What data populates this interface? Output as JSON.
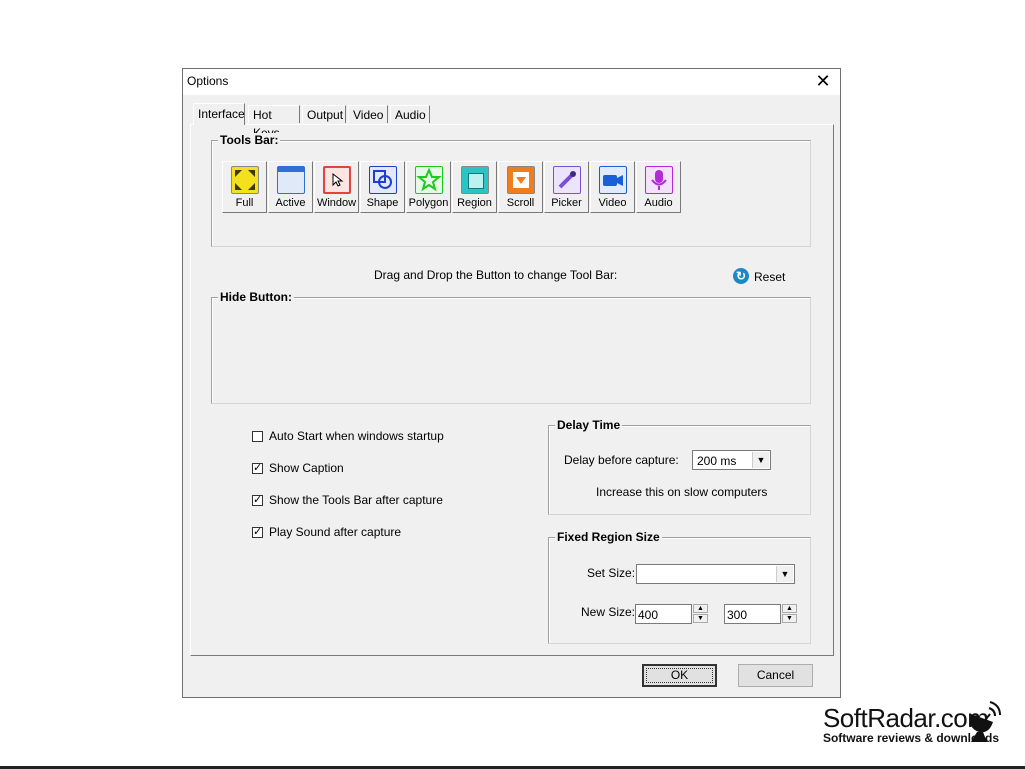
{
  "dialog": {
    "title": "Options",
    "tabs": [
      "Interface",
      "Hot Keys",
      "Output",
      "Video",
      "Audio"
    ],
    "active_tab": "Interface"
  },
  "tools_bar": {
    "label": "Tools Bar:",
    "buttons": [
      {
        "label": "Full",
        "icon": "full-screen-icon",
        "color": "#f2e11c"
      },
      {
        "label": "Active",
        "icon": "active-window-icon",
        "color": "#2f6fd6"
      },
      {
        "label": "Window",
        "icon": "window-cursor-icon",
        "color": "#e0443c"
      },
      {
        "label": "Shape",
        "icon": "shape-icon",
        "color": "#1d3fd0"
      },
      {
        "label": "Polygon",
        "icon": "polygon-star-icon",
        "color": "#1ec81e"
      },
      {
        "label": "Region",
        "icon": "region-lock-icon",
        "color": "#2cc3c3"
      },
      {
        "label": "Scroll",
        "icon": "scroll-icon",
        "color": "#ef7d1c"
      },
      {
        "label": "Picker",
        "icon": "color-picker-icon",
        "color": "#7b4fd6"
      },
      {
        "label": "Video",
        "icon": "video-camera-icon",
        "color": "#1b5fd8"
      },
      {
        "label": "Audio",
        "icon": "microphone-icon",
        "color": "#b22bd6"
      }
    ],
    "hint": "Drag and Drop the Button to change Tool Bar:",
    "reset_label": "Reset"
  },
  "hide_button": {
    "label": "Hide Button:"
  },
  "options": [
    {
      "label": "Auto Start when windows startup",
      "checked": false
    },
    {
      "label": "Show Caption",
      "checked": true
    },
    {
      "label": "Show the Tools Bar after capture",
      "checked": true
    },
    {
      "label": "Play Sound after capture",
      "checked": true
    }
  ],
  "delay_time": {
    "label": "Delay Time",
    "field_label": "Delay before capture:",
    "value": "200 ms",
    "note": "Increase this on slow computers"
  },
  "fixed_region": {
    "label": "Fixed Region Size",
    "set_size_label": "Set Size:",
    "set_size_value": "",
    "new_size_label": "New Size:",
    "width": "400",
    "height": "300"
  },
  "buttons": {
    "ok": "OK",
    "cancel": "Cancel"
  },
  "watermark": {
    "name": "SoftRadar.com",
    "tagline": "Software reviews & downloads"
  }
}
